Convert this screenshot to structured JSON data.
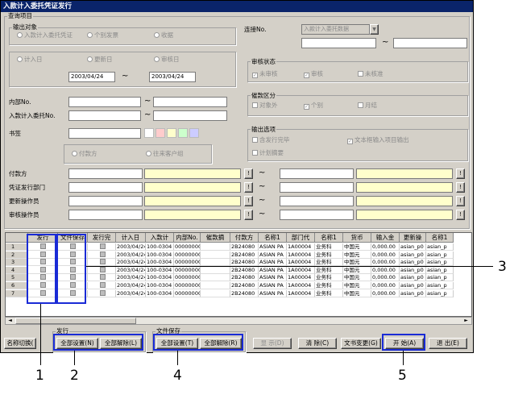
{
  "window": {
    "title": "入款计入委托凭证发行"
  },
  "query": {
    "group_label": "查询项目",
    "output_target": {
      "label": "输出对象",
      "options": [
        "入款计入委托凭证",
        "个别发票",
        "收据"
      ]
    },
    "date_type": {
      "options": [
        "计入日",
        "更新日",
        "审核日"
      ],
      "from": "2003/04/24",
      "to": "2003/04/24"
    },
    "internal_no_label": "内部No.",
    "entrust_no_label": "入款计入委托No.",
    "bookmark_label": "书签",
    "pay_type": {
      "options": [
        "付款方",
        "往来客户组"
      ]
    },
    "connection": {
      "label": "连接No.",
      "select_value": "入款计入委托数据"
    },
    "audit_status": {
      "label": "审核状态",
      "options": [
        "未审核",
        "审核",
        "未核准"
      ]
    },
    "collection_type": {
      "label": "催款区分",
      "options": [
        "对象外",
        "个别",
        "月结"
      ]
    },
    "output_options": {
      "label": "输出选项",
      "options": [
        "含发行完毕",
        "文本框输入项目输出",
        "计划摘要"
      ]
    },
    "ranges": [
      {
        "label": "付款方"
      },
      {
        "label": "凭证发行部门"
      },
      {
        "label": "更新操作员"
      },
      {
        "label": "审核操作员"
      }
    ],
    "range_button": "!",
    "range_sep": "~"
  },
  "grid": {
    "columns": [
      "发行",
      "文件保存",
      "发行完",
      "计入日",
      "入款计",
      "内部No.",
      "催款摘",
      "付款方",
      "名称1",
      "部门代",
      "名称1",
      "货币",
      "输入金",
      "更新操",
      "名称1"
    ],
    "row_numbers": [
      "1",
      "2",
      "3",
      "4",
      "5",
      "6",
      "7"
    ],
    "rows": [
      [
        "2003/04/24",
        "100-0304",
        "00000000",
        "",
        "2B24080",
        "ASIAN PA",
        "1A00004",
        "业务科",
        "中国元",
        "0,000.00",
        "asian_p0",
        "asian_p"
      ],
      [
        "2003/04/24",
        "100-0304",
        "00000000",
        "",
        "2B24080",
        "ASIAN PA",
        "1A00004",
        "业务科",
        "中国元",
        "0,000.00",
        "asian_p0",
        "asian_p"
      ],
      [
        "2003/04/24",
        "100-0304",
        "00000000",
        "",
        "2B24080",
        "ASIAN PA",
        "1A00004",
        "业务科",
        "中国元",
        "0,000.00",
        "asian_p0",
        "asian_p"
      ],
      [
        "2003/04/24",
        "100-0304",
        "00000000",
        "",
        "2B24080",
        "ASIAN PA",
        "1A00004",
        "业务科",
        "中国元",
        "0,000.00",
        "asian_p0",
        "asian_p"
      ],
      [
        "2003/04/24",
        "100-0304",
        "00000000",
        "",
        "2B24080",
        "ASIAN PA",
        "1A00004",
        "业务科",
        "中国元",
        "0,000.00",
        "asian_p0",
        "asian_p"
      ],
      [
        "2003/04/24",
        "100-0304",
        "00000000",
        "",
        "2B24080",
        "ASIAN PA",
        "1A00004",
        "业务科",
        "中国元",
        "0,000.00",
        "asian_p0",
        "asian_p"
      ],
      [
        "2003/04/24",
        "100-0304",
        "00000000",
        "",
        "2B24080",
        "ASIAN PA",
        "1A00004",
        "业务科",
        "中国元",
        "0,000.00",
        "asian_p0",
        "asian_p"
      ]
    ]
  },
  "bottom": {
    "name_toggle": "名称切换(",
    "issue_group": "发行",
    "issue_select_all": "全部设置(N)",
    "issue_clear_all": "全部解除(L)",
    "save_group": "文件保存",
    "save_select_all": "全部设置(T)",
    "save_clear_all": "全部解除(R)",
    "display": "显  示(D)",
    "clear": "清  除(C)",
    "text_change": "文书变更(G)",
    "start": "开  始(A)",
    "exit": "退  出(E)"
  },
  "callouts": [
    "1",
    "2",
    "3",
    "4",
    "5"
  ],
  "colors": {
    "titlebar": "#0a246a",
    "highlight": "#1a2bd6",
    "field_yellow": "#ffffcc",
    "face": "#d4d0c8"
  },
  "swatches": [
    "#ffffff",
    "#ffcccc",
    "#ffffcc",
    "#ccffcc",
    "#ccccff"
  ]
}
